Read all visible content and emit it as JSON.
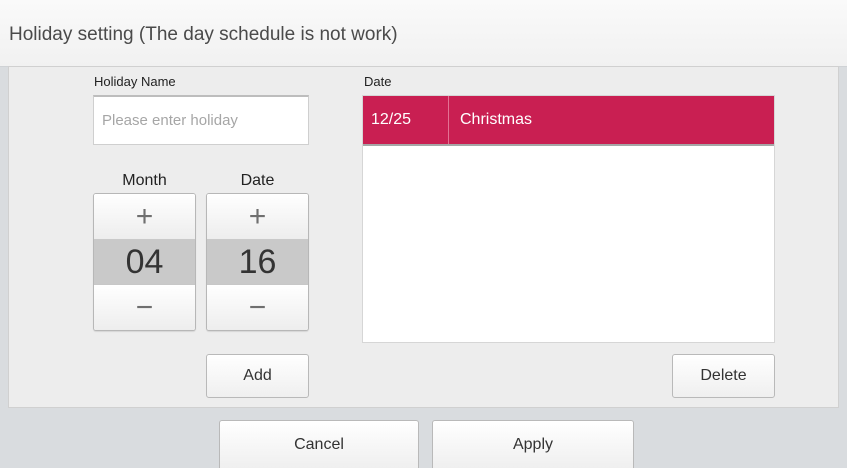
{
  "window": {
    "title": "Holiday setting (The day schedule is not work)"
  },
  "form": {
    "holiday_name_label": "Holiday Name",
    "holiday_name_placeholder": "Please enter holiday",
    "holiday_name_value": "",
    "month_label": "Month",
    "month_value": "04",
    "date_label": "Date",
    "date_value": "16",
    "plus_symbol": "+",
    "minus_symbol": "−",
    "add_label": "Add"
  },
  "list": {
    "header": "Date",
    "rows": [
      {
        "date": "12/25",
        "name": "Christmas",
        "selected": true
      }
    ],
    "selected_color": "#c91f52",
    "delete_label": "Delete"
  },
  "footer": {
    "cancel_label": "Cancel",
    "apply_label": "Apply"
  }
}
